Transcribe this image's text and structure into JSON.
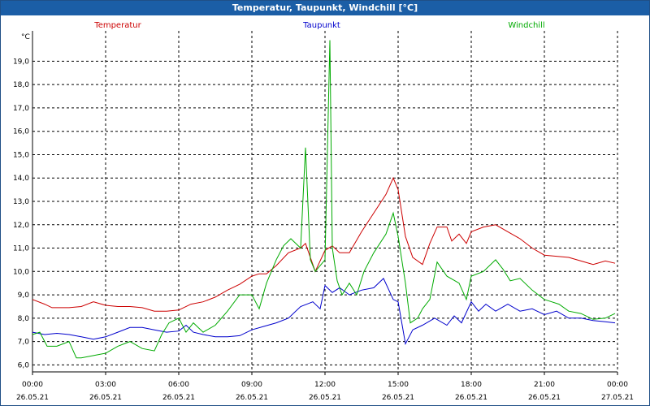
{
  "window": {
    "title": "Temperatur, Taupunkt, Windchill [°C]"
  },
  "chart_data": {
    "type": "line",
    "title": "Temperatur, Taupunkt, Windchill [°C]",
    "ylabel": "°C",
    "ylim": [
      5.7,
      20.3
    ],
    "xlim": [
      0,
      24
    ],
    "grid": true,
    "legend": "top",
    "yticks": [
      6,
      7,
      8,
      9,
      10,
      11,
      12,
      13,
      14,
      15,
      16,
      17,
      18,
      19
    ],
    "ytick_labels": [
      "6,0",
      "7,0",
      "8,0",
      "9,0",
      "10,0",
      "11,0",
      "12,0",
      "13,0",
      "14,0",
      "15,0",
      "16,0",
      "17,0",
      "18,0",
      "19,0"
    ],
    "xticks": [
      0,
      3,
      6,
      9,
      12,
      15,
      18,
      21,
      24
    ],
    "xtick_time": [
      "00:00",
      "03:00",
      "06:00",
      "09:00",
      "12:00",
      "15:00",
      "18:00",
      "21:00",
      "00:00"
    ],
    "xtick_date": [
      "26.05.21",
      "26.05.21",
      "26.05.21",
      "26.05.21",
      "26.05.21",
      "26.05.21",
      "26.05.21",
      "26.05.21",
      "27.05.21"
    ],
    "series": [
      {
        "name": "Temperatur",
        "color": "#cc0000",
        "x": [
          0,
          0.5,
          0.8,
          1.0,
          1.5,
          2.0,
          2.5,
          3.0,
          3.5,
          4.0,
          4.5,
          5.0,
          5.5,
          6.0,
          6.5,
          7.0,
          7.5,
          8.0,
          8.5,
          9.0,
          9.3,
          9.6,
          10.0,
          10.5,
          11.0,
          11.2,
          11.6,
          12.0,
          12.3,
          12.6,
          13.0,
          13.5,
          14.0,
          14.5,
          14.8,
          15.0,
          15.3,
          15.6,
          16.0,
          16.3,
          16.6,
          17.0,
          17.2,
          17.5,
          17.8,
          18.0,
          18.5,
          19.0,
          19.5,
          20.0,
          20.5,
          21.0,
          21.5,
          22.0,
          22.5,
          23.0,
          23.5,
          23.9
        ],
        "values": [
          8.8,
          8.6,
          8.45,
          8.45,
          8.45,
          8.5,
          8.7,
          8.55,
          8.5,
          8.5,
          8.45,
          8.3,
          8.3,
          8.35,
          8.6,
          8.7,
          8.9,
          9.2,
          9.45,
          9.8,
          9.9,
          9.9,
          10.25,
          10.8,
          11.0,
          11.2,
          10.0,
          10.9,
          11.1,
          10.8,
          10.8,
          11.7,
          12.5,
          13.3,
          14.0,
          13.5,
          11.5,
          10.6,
          10.3,
          11.2,
          11.9,
          11.9,
          11.3,
          11.6,
          11.2,
          11.7,
          11.9,
          12.0,
          11.7,
          11.4,
          11.0,
          10.7,
          10.65,
          10.6,
          10.45,
          10.3,
          10.45,
          10.35
        ]
      },
      {
        "name": "Taupunkt",
        "color": "#0000cc",
        "x": [
          0,
          0.5,
          1.0,
          1.5,
          2.0,
          2.5,
          3.0,
          3.5,
          4.0,
          4.5,
          5.0,
          5.5,
          6.0,
          6.3,
          6.6,
          7.0,
          7.5,
          8.0,
          8.5,
          9.0,
          9.5,
          10.0,
          10.5,
          11.0,
          11.5,
          11.8,
          12.0,
          12.3,
          12.6,
          13.0,
          13.5,
          14.0,
          14.4,
          14.8,
          15.0,
          15.3,
          15.6,
          16.0,
          16.5,
          17.0,
          17.3,
          17.6,
          18.0,
          18.3,
          18.6,
          19.0,
          19.5,
          20.0,
          20.5,
          21.0,
          21.5,
          22.0,
          22.5,
          23.0,
          23.5,
          23.9
        ],
        "values": [
          7.4,
          7.3,
          7.35,
          7.3,
          7.2,
          7.1,
          7.2,
          7.4,
          7.6,
          7.6,
          7.5,
          7.4,
          7.45,
          7.7,
          7.4,
          7.3,
          7.2,
          7.2,
          7.25,
          7.5,
          7.65,
          7.8,
          8.0,
          8.5,
          8.7,
          8.4,
          9.4,
          9.1,
          9.3,
          9.0,
          9.2,
          9.3,
          9.7,
          8.8,
          8.7,
          6.9,
          7.5,
          7.7,
          8.0,
          7.7,
          8.1,
          7.8,
          8.7,
          8.3,
          8.6,
          8.3,
          8.6,
          8.3,
          8.4,
          8.15,
          8.3,
          8.0,
          8.0,
          7.9,
          7.85,
          7.8
        ]
      },
      {
        "name": "Windchill",
        "color": "#00aa00",
        "x": [
          0,
          0.3,
          0.6,
          1.0,
          1.5,
          1.8,
          2.0,
          2.5,
          3.0,
          3.5,
          4.0,
          4.5,
          5.0,
          5.3,
          5.6,
          6.0,
          6.3,
          6.6,
          7.0,
          7.5,
          8.0,
          8.5,
          9.0,
          9.3,
          9.6,
          10.0,
          10.3,
          10.6,
          11.0,
          11.2,
          11.4,
          11.6,
          12.0,
          12.2,
          12.3,
          12.5,
          12.7,
          13.0,
          13.3,
          13.6,
          14.0,
          14.5,
          14.8,
          15.0,
          15.3,
          15.5,
          15.8,
          16.0,
          16.3,
          16.6,
          17.0,
          17.5,
          17.8,
          18.0,
          18.5,
          19.0,
          19.3,
          19.6,
          20.0,
          20.5,
          21.0,
          21.3,
          21.6,
          22.0,
          22.5,
          23.0,
          23.5,
          23.9
        ],
        "values": [
          7.3,
          7.4,
          6.8,
          6.8,
          7.0,
          6.3,
          6.3,
          6.4,
          6.5,
          6.8,
          7.0,
          6.7,
          6.6,
          7.3,
          7.8,
          8.0,
          7.4,
          7.8,
          7.4,
          7.7,
          8.3,
          9.0,
          9.0,
          8.4,
          9.5,
          10.5,
          11.1,
          11.4,
          11.0,
          15.3,
          10.5,
          10.0,
          10.5,
          19.9,
          11.0,
          9.6,
          9.0,
          9.5,
          9.0,
          10.0,
          10.8,
          11.6,
          12.5,
          11.5,
          9.5,
          7.8,
          8.0,
          8.4,
          8.8,
          10.4,
          9.8,
          9.5,
          8.8,
          9.8,
          10.0,
          10.5,
          10.1,
          9.6,
          9.7,
          9.2,
          8.8,
          8.7,
          8.6,
          8.3,
          8.2,
          7.95,
          8.0,
          8.2
        ]
      }
    ]
  }
}
